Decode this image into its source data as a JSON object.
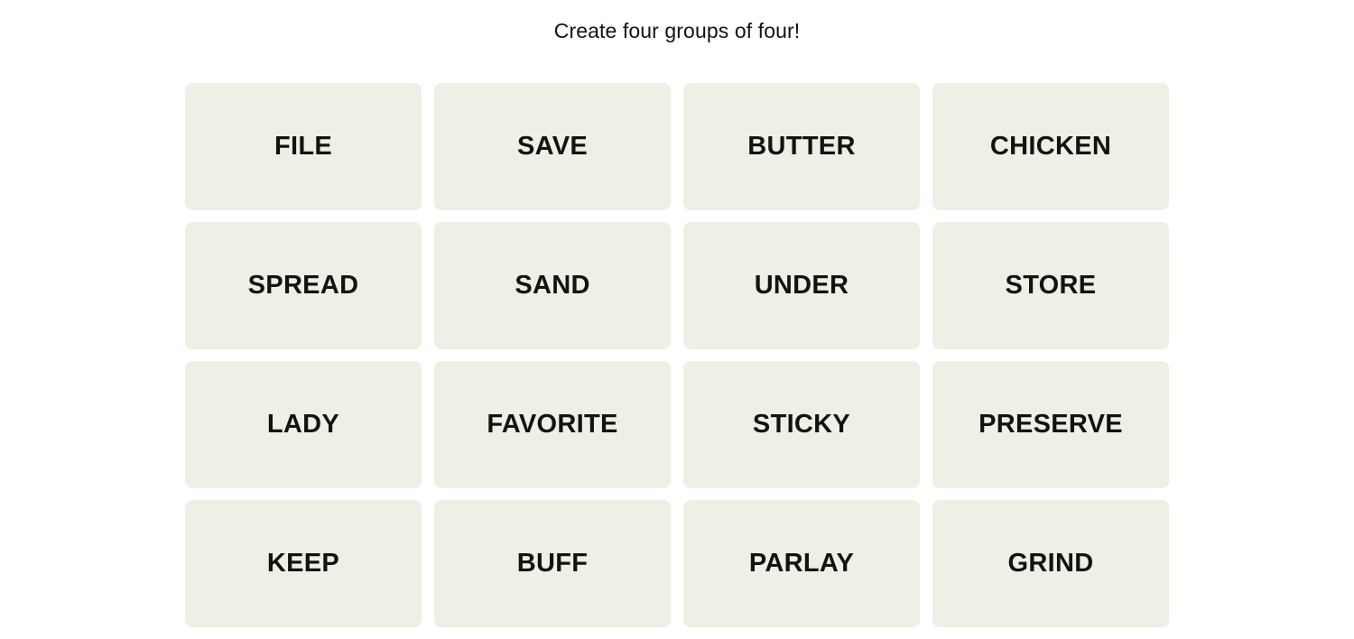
{
  "game": {
    "instruction": "Create four groups of four!",
    "colors": {
      "page_background": "#ffffff",
      "tile_background": "#efefe6",
      "text": "#121212"
    },
    "grid": {
      "rows": 4,
      "columns": 4
    },
    "tiles": [
      {
        "label": "FILE"
      },
      {
        "label": "SAVE"
      },
      {
        "label": "BUTTER"
      },
      {
        "label": "CHICKEN"
      },
      {
        "label": "SPREAD"
      },
      {
        "label": "SAND"
      },
      {
        "label": "UNDER"
      },
      {
        "label": "STORE"
      },
      {
        "label": "LADY"
      },
      {
        "label": "FAVORITE"
      },
      {
        "label": "STICKY"
      },
      {
        "label": "PRESERVE"
      },
      {
        "label": "KEEP"
      },
      {
        "label": "BUFF"
      },
      {
        "label": "PARLAY"
      },
      {
        "label": "GRIND"
      }
    ]
  }
}
